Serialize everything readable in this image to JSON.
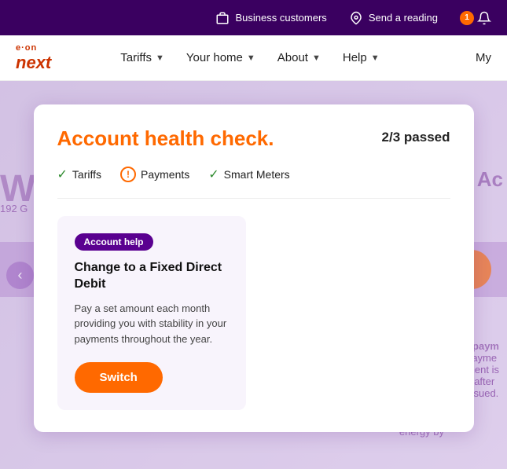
{
  "topbar": {
    "business_label": "Business customers",
    "send_reading_label": "Send a reading",
    "notification_count": "1"
  },
  "mainnav": {
    "logo_eon": "e·on",
    "logo_next": "next",
    "tariffs_label": "Tariffs",
    "your_home_label": "Your home",
    "about_label": "About",
    "help_label": "Help",
    "my_label": "My"
  },
  "modal": {
    "title": "Account health check.",
    "passed": "2/3 passed",
    "check_tariffs_label": "Tariffs",
    "check_payments_label": "Payments",
    "check_smart_meters_label": "Smart Meters",
    "card_tag": "Account help",
    "card_title": "Change to a Fixed Direct Debit",
    "card_desc": "Pay a set amount each month providing you with stability in your payments throughout the year.",
    "switch_label": "Switch"
  },
  "bg": {
    "we_text": "We",
    "ac_text": "Ac",
    "address": "192 G",
    "next_payment_title": "t paym",
    "next_payment_text1": "payme",
    "next_payment_text2": "ment is",
    "next_payment_text3": "s after",
    "next_payment_text4": "issued.",
    "energy_text": "energy by"
  }
}
